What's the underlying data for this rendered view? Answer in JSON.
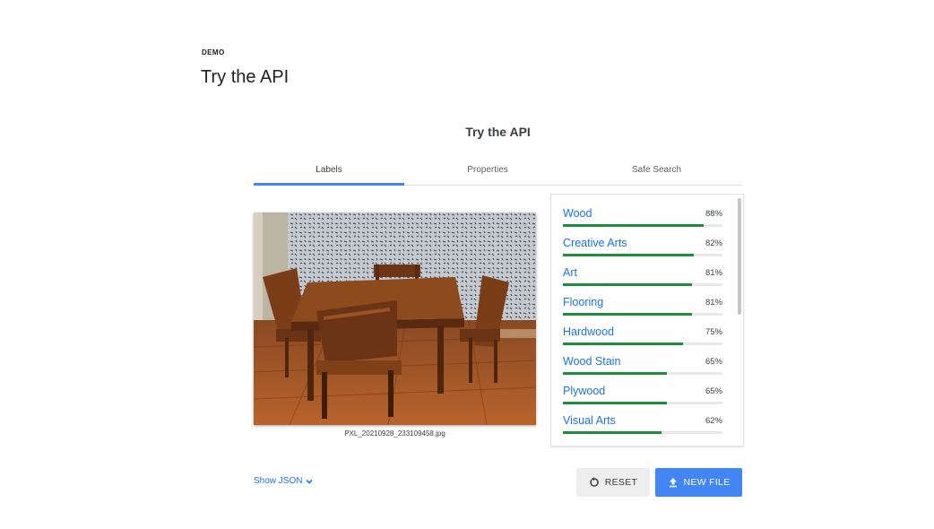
{
  "header": {
    "eyebrow": "DEMO",
    "title": "Try the API"
  },
  "card": {
    "title": "Try the API",
    "tabs": [
      {
        "label": "Labels",
        "active": true
      },
      {
        "label": "Properties",
        "active": false
      },
      {
        "label": "Safe Search",
        "active": false
      }
    ],
    "image": {
      "filename": "PXL_20210928_233109458.jpg"
    },
    "labels": [
      {
        "name": "Wood",
        "percent": "88%",
        "score": 0.88
      },
      {
        "name": "Creative Arts",
        "percent": "82%",
        "score": 0.82
      },
      {
        "name": "Art",
        "percent": "81%",
        "score": 0.81
      },
      {
        "name": "Flooring",
        "percent": "81%",
        "score": 0.81
      },
      {
        "name": "Hardwood",
        "percent": "75%",
        "score": 0.75
      },
      {
        "name": "Wood Stain",
        "percent": "65%",
        "score": 0.65
      },
      {
        "name": "Plywood",
        "percent": "65%",
        "score": 0.65
      },
      {
        "name": "Visual Arts",
        "percent": "62%",
        "score": 0.62
      }
    ],
    "show_json": "Show JSON",
    "buttons": {
      "reset": "RESET",
      "new_file": "NEW FILE"
    }
  },
  "colors": {
    "accent": "#4285f4",
    "link": "#1a73e8",
    "bar": "#1e8e3e"
  }
}
